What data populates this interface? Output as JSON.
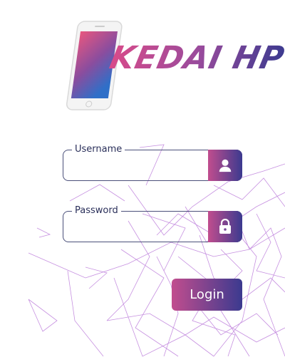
{
  "brand": {
    "name": "KEDAI HP"
  },
  "form": {
    "username": {
      "label": "Username",
      "value": "",
      "placeholder": ""
    },
    "password": {
      "label": "Password",
      "value": "",
      "placeholder": ""
    },
    "login_label": "Login"
  },
  "icons": {
    "username": "user-icon",
    "password": "lock-icon"
  },
  "colors": {
    "accent_start": "#c14d8e",
    "accent_end": "#3b3a8f",
    "field_border": "#4a4f7a"
  }
}
